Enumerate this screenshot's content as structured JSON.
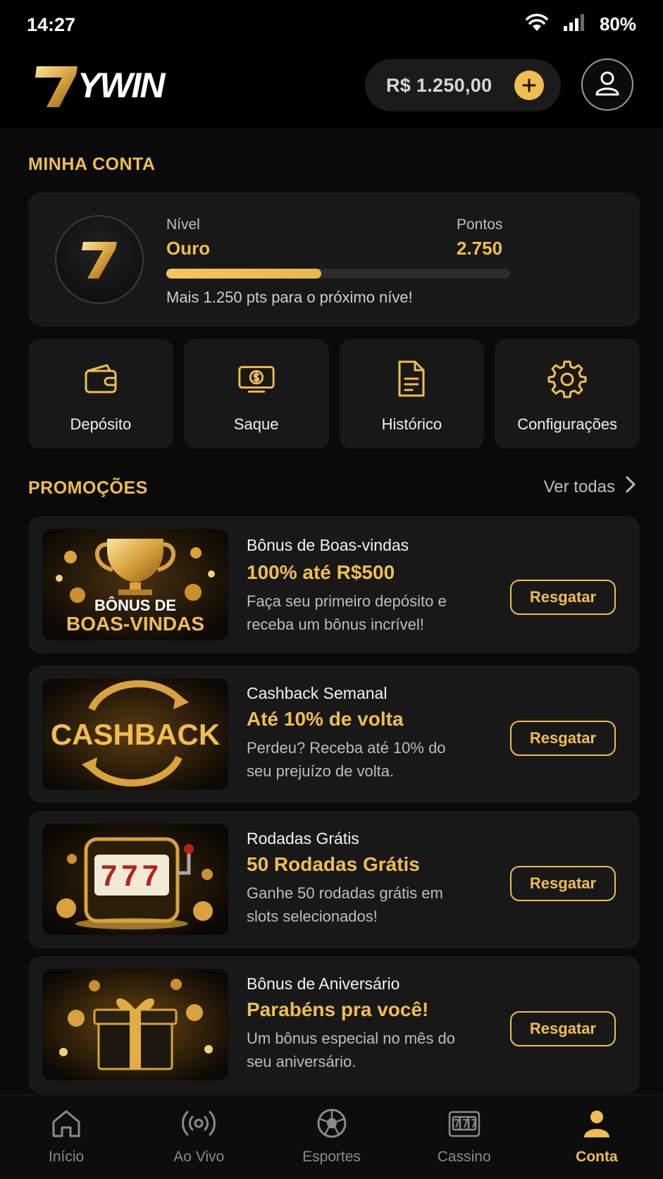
{
  "status_bar": {
    "time": "14:27",
    "battery": "80%"
  },
  "header": {
    "logo_text": "7YWIN",
    "balance": "R$ 1.250,00"
  },
  "account": {
    "section_title": "MINHA CONTA",
    "level_label": "Nível",
    "level_value": "Ouro",
    "points_label": "Pontos",
    "points_value": "2.750",
    "progress": 0.45,
    "hint": "Mais 1.250 pts para o próximo níve!",
    "actions": [
      {
        "label": "Depósito",
        "icon": "wallet-icon"
      },
      {
        "label": "Saque",
        "icon": "cash-icon"
      },
      {
        "label": "Histórico",
        "icon": "document-icon"
      },
      {
        "label": "Configurações",
        "icon": "gear-icon"
      }
    ]
  },
  "promotions": {
    "section_title": "PROMOÇÕES",
    "see_all": "Ver todas",
    "items": [
      {
        "small": "Bônus de Boas-vindas",
        "headline": "100% até R$500",
        "desc": "Faça seu primeiro depósito e receba um bônus incrível!",
        "image_text_1": "BÔNUS DE",
        "image_text_2": "BOAS-VINDAS",
        "button": "Resgatar"
      },
      {
        "small": "Cashback Semanal",
        "headline": "Até 10% de volta",
        "desc": "Perdeu? Receba até 10% do seu prejuízo de volta.",
        "image_text_1": "CASHBACK",
        "button": "Resgatar"
      },
      {
        "small": "Rodadas Grátis",
        "headline": "50 Rodadas Grátis",
        "desc": "Ganhe 50 rodadas grátis em slots selecionados!",
        "image_text_1": "777",
        "button": "Resgatar"
      },
      {
        "small": "Bônus de Aniversário",
        "headline": "Parabéns pra você!",
        "desc": "Um bônus especial no mês do seu aniversário.",
        "button": "Resgatar"
      }
    ]
  },
  "bottom_nav": [
    {
      "label": "Início",
      "icon": "home-icon",
      "active": false
    },
    {
      "label": "Ao Vivo",
      "icon": "live-icon",
      "active": false
    },
    {
      "label": "Esportes",
      "icon": "soccer-ball-icon",
      "active": false
    },
    {
      "label": "Cassino",
      "icon": "slot-machine-icon",
      "active": false
    },
    {
      "label": "Conta",
      "icon": "user-icon",
      "active": true
    }
  ],
  "colors": {
    "accent": "#f0bd50",
    "card": "#181818",
    "background": "#0a0a0a"
  }
}
